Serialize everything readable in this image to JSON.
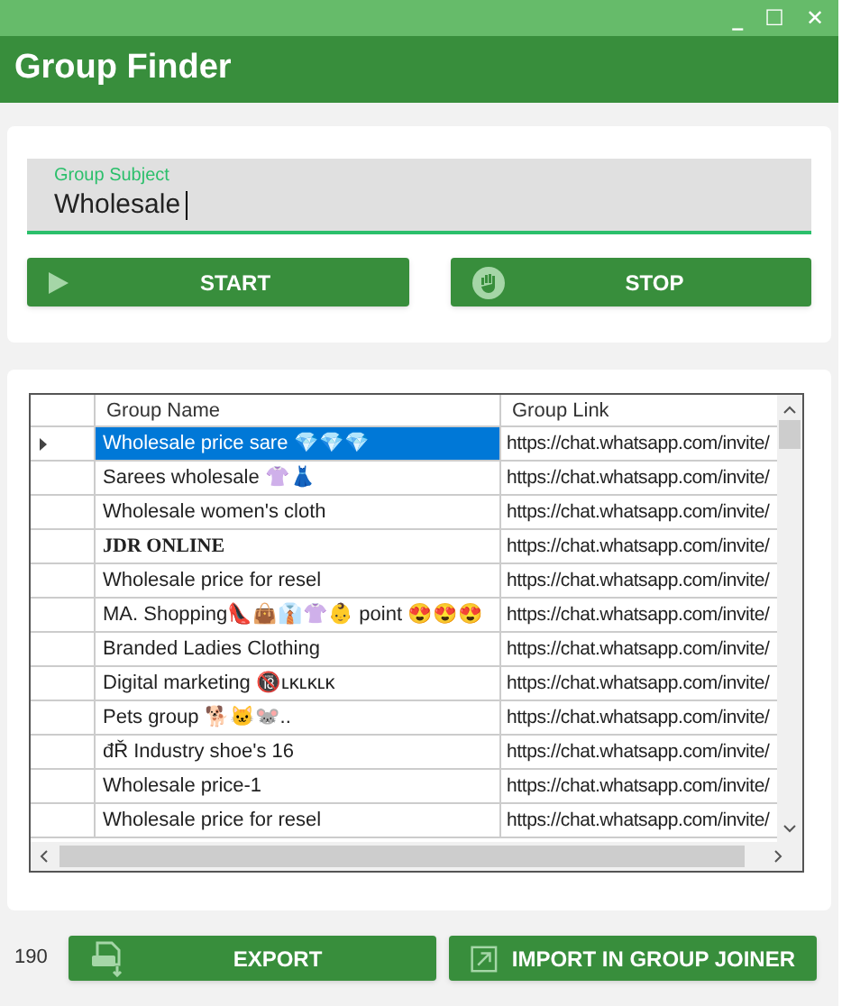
{
  "window": {
    "title": "Group Finder",
    "controls": [
      "_",
      "☐",
      "✕"
    ]
  },
  "search": {
    "label": "Group Subject",
    "value": "Wholesale"
  },
  "buttons": [
    {
      "label": "START",
      "kind": "play"
    },
    {
      "label": "STOP",
      "kind": "hand"
    }
  ],
  "table": {
    "columns": [
      "Group Name",
      "Group Link"
    ],
    "rows": [
      {
        "name": "Wholesale price sare 💎💎💎",
        "link": "https://chat.whatsapp.com/invite/",
        "selected": true
      },
      {
        "name": "Sarees wholesale 👚👗",
        "link": "https://chat.whatsapp.com/invite/",
        "selected": false
      },
      {
        "name": "Wholesale women's cloth",
        "link": "https://chat.whatsapp.com/invite/",
        "selected": false
      },
      {
        "name": "JDR ONLINE",
        "link": "https://chat.whatsapp.com/invite/",
        "selected": false,
        "bold": true
      },
      {
        "name": "Wholesale price for resel",
        "link": "https://chat.whatsapp.com/invite/",
        "selected": false
      },
      {
        "name": "MA. Shopping👠👜👔👚👶 point 😍😍😍",
        "link": "https://chat.whatsapp.com/invite/",
        "selected": false
      },
      {
        "name": "Branded Ladies Clothing",
        "link": "https://chat.whatsapp.com/invite/",
        "selected": false
      },
      {
        "name": "Digital marketing 🔞ʟᴋʟᴋʟᴋ",
        "link": "https://chat.whatsapp.com/invite/",
        "selected": false
      },
      {
        "name": "Pets group 🐕🐱🐭..",
        "link": "https://chat.whatsapp.com/invite/",
        "selected": false
      },
      {
        "name": "đŘ Industry shoe's 16",
        "link": "https://chat.whatsapp.com/invite/",
        "selected": false
      },
      {
        "name": "Wholesale price-1",
        "link": "https://chat.whatsapp.com/invite/",
        "selected": false
      },
      {
        "name": "Wholesale price for resel",
        "link": "https://chat.whatsapp.com/invite/",
        "selected": false
      }
    ]
  },
  "count": "190",
  "footer_buttons": [
    {
      "label": "EXPORT",
      "kind": "xls"
    },
    {
      "label": "IMPORT IN GROUP JOINER",
      "kind": "import"
    }
  ]
}
